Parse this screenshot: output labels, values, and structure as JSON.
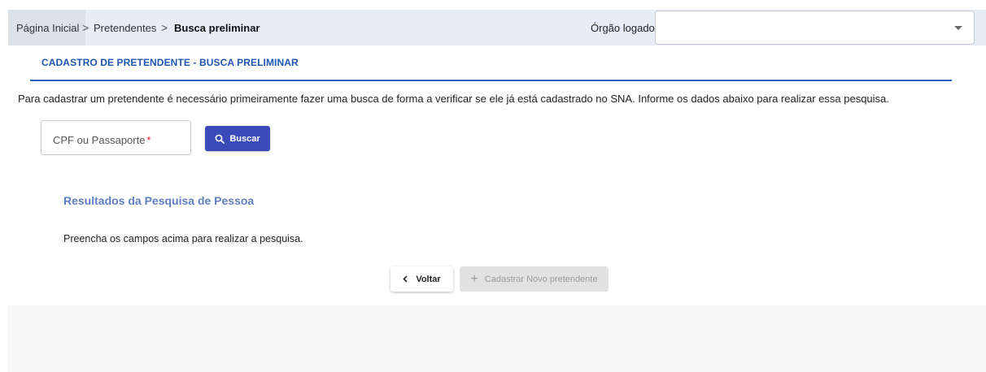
{
  "breadcrumb": {
    "items": [
      "Página Inicial",
      "Pretendentes",
      "Busca preliminar"
    ],
    "separator": ">"
  },
  "header": {
    "org_label": "Órgão logado",
    "org_value": ""
  },
  "section": {
    "title": "CADASTRO DE PRETENDENTE - BUSCA PRELIMINAR",
    "intro": "Para cadastrar um pretendente é necessário primeiramente fazer uma busca de forma a verificar se ele já está cadastrado no SNA. Informe os dados abaixo para realizar essa pesquisa."
  },
  "search": {
    "field_label": "CPF ou Passaporte",
    "required_mark": "*",
    "value": "",
    "button_label": "Buscar"
  },
  "results": {
    "title": "Resultados da Pesquisa de Pessoa",
    "empty_message": "Preencha os campos acima para realizar a pesquisa."
  },
  "actions": {
    "back_label": "Voltar",
    "new_label": "Cadastrar Novo pretendente"
  },
  "colors": {
    "accent": "#1f55b0",
    "button_primary": "#3a4ab8",
    "results_title": "#5f7fc0",
    "required": "#e02020"
  }
}
